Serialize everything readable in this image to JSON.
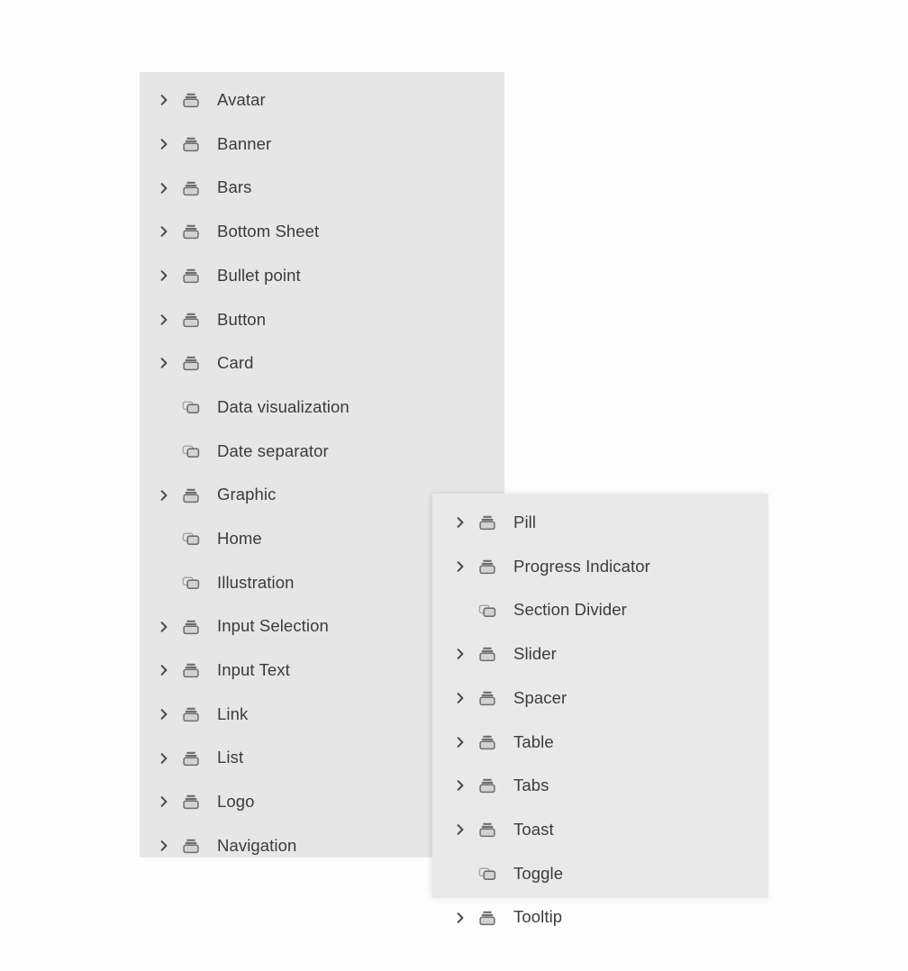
{
  "theme": {
    "page_background": "#fdfdfd",
    "panel_background": "#e6e6e6",
    "panel_background_secondary": "#e9e9e9",
    "label_color": "#3b3b3b",
    "icon_color": "#6e6e6e",
    "chevron_color": "#4a4a4a"
  },
  "panels": [
    {
      "name": "components-list-primary",
      "items": [
        {
          "label": "Avatar",
          "icon": "component-icon",
          "expandable": true
        },
        {
          "label": "Banner",
          "icon": "component-icon",
          "expandable": true
        },
        {
          "label": "Bars",
          "icon": "component-icon",
          "expandable": true
        },
        {
          "label": "Bottom Sheet",
          "icon": "component-icon",
          "expandable": true
        },
        {
          "label": "Bullet point",
          "icon": "component-icon",
          "expandable": true
        },
        {
          "label": "Button",
          "icon": "component-icon",
          "expandable": true
        },
        {
          "label": "Card",
          "icon": "component-icon",
          "expandable": true
        },
        {
          "label": "Data visualization",
          "icon": "instance-icon",
          "expandable": false
        },
        {
          "label": "Date separator",
          "icon": "instance-icon",
          "expandable": false
        },
        {
          "label": "Graphic",
          "icon": "component-icon",
          "expandable": true
        },
        {
          "label": "Home",
          "icon": "instance-icon",
          "expandable": false
        },
        {
          "label": "Illustration",
          "icon": "instance-icon",
          "expandable": false
        },
        {
          "label": "Input Selection",
          "icon": "component-icon",
          "expandable": true
        },
        {
          "label": "Input Text",
          "icon": "component-icon",
          "expandable": true
        },
        {
          "label": "Link",
          "icon": "component-icon",
          "expandable": true
        },
        {
          "label": "List",
          "icon": "component-icon",
          "expandable": true
        },
        {
          "label": "Logo",
          "icon": "component-icon",
          "expandable": true
        },
        {
          "label": "Navigation",
          "icon": "component-icon",
          "expandable": true
        }
      ]
    },
    {
      "name": "components-list-secondary",
      "items": [
        {
          "label": "Pill",
          "icon": "component-icon",
          "expandable": true
        },
        {
          "label": "Progress Indicator",
          "icon": "component-icon",
          "expandable": true
        },
        {
          "label": "Section Divider",
          "icon": "instance-icon",
          "expandable": false
        },
        {
          "label": "Slider",
          "icon": "component-icon",
          "expandable": true
        },
        {
          "label": "Spacer",
          "icon": "component-icon",
          "expandable": true
        },
        {
          "label": "Table",
          "icon": "component-icon",
          "expandable": true
        },
        {
          "label": "Tabs",
          "icon": "component-icon",
          "expandable": true
        },
        {
          "label": "Toast",
          "icon": "component-icon",
          "expandable": true
        },
        {
          "label": "Toggle",
          "icon": "instance-icon",
          "expandable": false
        },
        {
          "label": "Tooltip",
          "icon": "component-icon",
          "expandable": true
        }
      ]
    }
  ]
}
